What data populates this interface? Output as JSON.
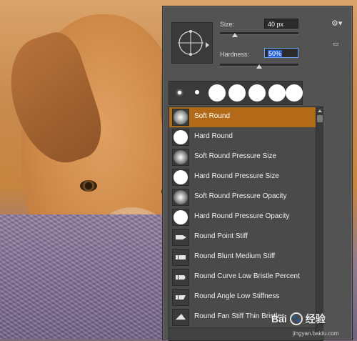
{
  "brush_panel": {
    "size_label": "Size:",
    "size_value": "40 px",
    "hardness_label": "Hardness:",
    "hardness_value": "50%",
    "gear_icon": "gear-icon",
    "new_preset_icon": "new-preset-icon",
    "accent_color": "#b36a18",
    "size_slider_level": 0.2,
    "hardness_slider_level": 0.5
  },
  "tips_strip": {
    "tips": [
      "small-soft",
      "small-hard",
      "large",
      "large",
      "large",
      "large",
      "large"
    ]
  },
  "brush_list": {
    "items": [
      {
        "label": "Soft Round",
        "selected": true,
        "thumb": "soft"
      },
      {
        "label": "Hard Round",
        "selected": false,
        "thumb": "hard"
      },
      {
        "label": "Soft Round Pressure Size",
        "selected": false,
        "thumb": "soft"
      },
      {
        "label": "Hard Round Pressure Size",
        "selected": false,
        "thumb": "hard"
      },
      {
        "label": "Soft Round Pressure Opacity",
        "selected": false,
        "thumb": "soft"
      },
      {
        "label": "Hard Round Pressure Opacity",
        "selected": false,
        "thumb": "hard"
      },
      {
        "label": "Round Point Stiff",
        "selected": false,
        "thumb": "bristle"
      },
      {
        "label": "Round Blunt Medium Stiff",
        "selected": false,
        "thumb": "bristle"
      },
      {
        "label": "Round Curve Low Bristle Percent",
        "selected": false,
        "thumb": "bristle"
      },
      {
        "label": "Round Angle Low Stiffness",
        "selected": false,
        "thumb": "bristle"
      },
      {
        "label": "Round Fan Stiff Thin Bristles",
        "selected": false,
        "thumb": "bristle"
      }
    ]
  },
  "watermark": {
    "brand": "Bai",
    "brand2": "经验",
    "sub": "jingyan.baidu.com"
  }
}
